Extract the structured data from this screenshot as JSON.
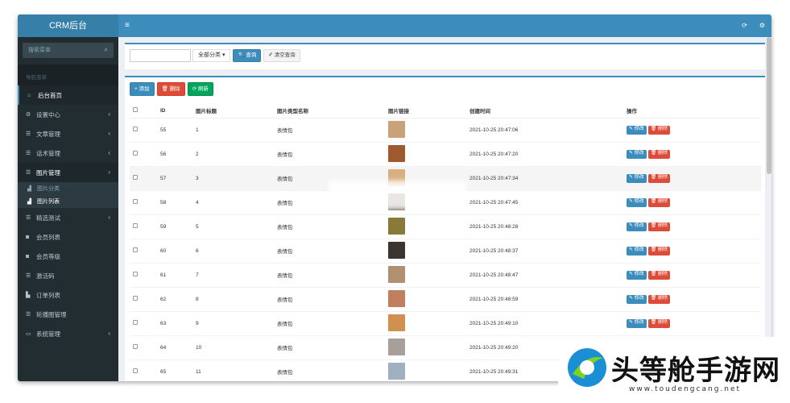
{
  "sidebar": {
    "brand": "CRM后台",
    "search_placeholder": "搜索菜单",
    "nav_header": "导航菜单",
    "items": [
      {
        "label": "后台首页",
        "icon": "home-icon",
        "glyph": "⌂",
        "arrow": ""
      },
      {
        "label": "设置中心",
        "icon": "cogs-icon",
        "glyph": "⚙",
        "arrow": "‹"
      },
      {
        "label": "文章管理",
        "icon": "list-icon",
        "glyph": "☰",
        "arrow": "‹"
      },
      {
        "label": "话术管理",
        "icon": "list-icon",
        "glyph": "☰",
        "arrow": "‹"
      },
      {
        "label": "图片管理",
        "icon": "list-icon",
        "glyph": "☰",
        "arrow": "›"
      }
    ],
    "sub_items": [
      {
        "label": "图片分类",
        "icon": "chart-icon",
        "glyph": "▟"
      },
      {
        "label": "图片列表",
        "icon": "chart-icon",
        "glyph": "▟"
      }
    ],
    "items2": [
      {
        "label": "精选测试",
        "icon": "list-icon",
        "glyph": "☰",
        "arrow": "‹"
      },
      {
        "label": "会员列表",
        "icon": "user-icon",
        "glyph": "◙",
        "arrow": ""
      },
      {
        "label": "会员等级",
        "icon": "user-icon",
        "glyph": "◙",
        "arrow": ""
      },
      {
        "label": "激活码",
        "icon": "list-icon",
        "glyph": "☰",
        "arrow": ""
      },
      {
        "label": "订单列表",
        "icon": "bar-chart-icon",
        "glyph": "▙",
        "arrow": ""
      },
      {
        "label": "轮播图管理",
        "icon": "list-icon",
        "glyph": "☰",
        "arrow": ""
      },
      {
        "label": "系统管理",
        "icon": "desktop-icon",
        "glyph": "▭",
        "arrow": "‹"
      }
    ]
  },
  "topbar": {
    "menu_glyph": "≡",
    "refresh_glyph": "⟳",
    "settings_glyph": "⚙"
  },
  "filter": {
    "category_select": "全部分类 ▾",
    "query_button": "🔍 查询",
    "clear_button": "✐ 清空查询"
  },
  "toolbar": {
    "add": "+ 添加",
    "delete": "🗑 删除",
    "refresh": "⟳ 刷新"
  },
  "table": {
    "headers": [
      "ID",
      "图片标题",
      "图片类型名称",
      "图片链接",
      "创建时间",
      "操作"
    ],
    "edit_label": "✎ 修改",
    "delete_label": "🗑 删除",
    "rows": [
      {
        "id": "55",
        "title": "1",
        "type": "表情包",
        "time": "2021-10-25 20:47:06",
        "color": "#c9a27a"
      },
      {
        "id": "56",
        "title": "2",
        "type": "表情包",
        "time": "2021-10-25 20:47:20",
        "color": "#a05a30"
      },
      {
        "id": "57",
        "title": "3",
        "type": "表情包",
        "time": "2021-10-25 20:47:34",
        "color": "#d8b080"
      },
      {
        "id": "58",
        "title": "4",
        "type": "表情包",
        "time": "2021-10-25 20:47:45",
        "color": "#6b5a48"
      },
      {
        "id": "59",
        "title": "5",
        "type": "表情包",
        "time": "2021-10-25 20:48:28",
        "color": "#8a7a3a"
      },
      {
        "id": "60",
        "title": "6",
        "type": "表情包",
        "time": "2021-10-25 20:48:37",
        "color": "#3a3530"
      },
      {
        "id": "61",
        "title": "7",
        "type": "表情包",
        "time": "2021-10-25 20:48:47",
        "color": "#b09070"
      },
      {
        "id": "62",
        "title": "8",
        "type": "表情包",
        "time": "2021-10-25 20:48:59",
        "color": "#c08060"
      },
      {
        "id": "63",
        "title": "9",
        "type": "表情包",
        "time": "2021-10-25 20:49:10",
        "color": "#d09050"
      },
      {
        "id": "64",
        "title": "10",
        "type": "表情包",
        "time": "2021-10-25 20:49:20",
        "color": "#a8a098"
      },
      {
        "id": "65",
        "title": "11",
        "type": "表情包",
        "time": "2021-10-25 20:49:31",
        "color": "#9fb0c0"
      }
    ]
  },
  "watermark": {
    "cn": "头等舱手游网",
    "en": "www.toudengcang.net"
  }
}
